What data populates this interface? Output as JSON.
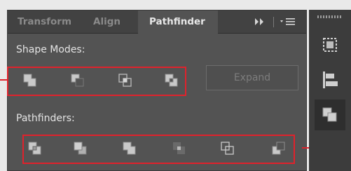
{
  "tabs": [
    {
      "label": "Transform",
      "active": false
    },
    {
      "label": "Align",
      "active": false
    },
    {
      "label": "Pathfinder",
      "active": true
    }
  ],
  "tab_controls": {
    "expand_icon": "double-chevron-right-icon",
    "menu_icon": "panel-menu-icon"
  },
  "shape_modes": {
    "label": "Shape Modes:",
    "buttons": [
      "unite-icon",
      "minus-front-icon",
      "intersect-icon",
      "exclude-icon"
    ],
    "expand_label": "Expand"
  },
  "pathfinders": {
    "label": "Pathfinders:",
    "buttons": [
      "divide-icon",
      "trim-icon",
      "merge-icon",
      "crop-icon",
      "outline-icon",
      "minus-back-icon"
    ]
  },
  "right_toolbar": [
    "transform-panel-icon",
    "align-panel-icon",
    "pathfinder-panel-icon"
  ],
  "colors": {
    "panel": "#535353",
    "tabbar": "#424242",
    "highlight": "#e0222c",
    "text": "#e4e4e4"
  }
}
